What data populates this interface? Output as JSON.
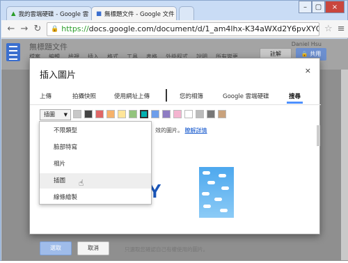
{
  "browser": {
    "tabs": [
      {
        "label": "我的雲端硬碟 - Google 雲"
      },
      {
        "label": "無標題文件 - Google 文件"
      }
    ],
    "url_scheme": "https://",
    "url_rest": "docs.google.com/document/d/1_am4lhx-K34aWXd2Y6pvXYGVNDBh"
  },
  "docs": {
    "title": "無標題文件",
    "menu": [
      "檔案",
      "編輯",
      "檢視",
      "插入",
      "格式",
      "工具",
      "表格",
      "外掛程式",
      "說明",
      "所有變更"
    ],
    "user": "Daniel Hsu",
    "comment_label": "註解",
    "share_label": "共用"
  },
  "dialog": {
    "title": "插入圖片",
    "close": "×",
    "tabs": [
      "上傳",
      "拍攝快照",
      "使用網址上傳",
      "您的相簿",
      "Google 雲端硬碟",
      "搜尋"
    ],
    "selected_tab": "搜尋",
    "filter_value": "插圖",
    "swatch_colors": [
      "#c8c8c8",
      "#444444",
      "#e06666",
      "#f6b26b",
      "#ffe599",
      "#93c47d",
      "#00b0b0",
      "#6d9eeb",
      "#8e7cc3",
      "#f4b4d0",
      "#ffffff",
      "#bbbbbb",
      "#777777",
      "#c9a27c"
    ],
    "dropdown_items": [
      "不限類型",
      "臉部特寫",
      "相片",
      "插圖",
      "線條繪製"
    ],
    "highlighted_item": "插圖",
    "hint_text": "效的圖片。",
    "hint_link": "瞭解詳情",
    "pick_button": "選取",
    "cancel_button": "取消",
    "footer_note": "只選取您確認自己有權使用的圖片。"
  }
}
